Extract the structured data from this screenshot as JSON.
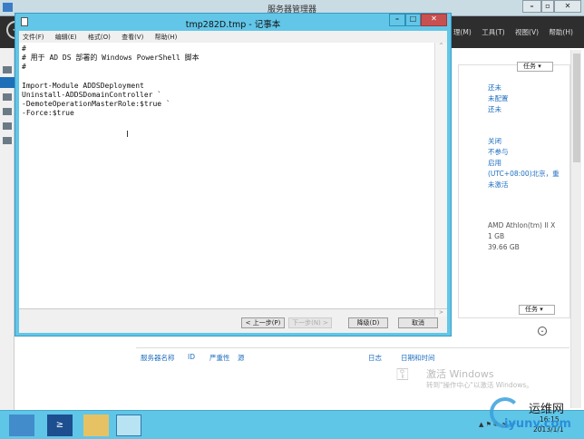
{
  "server_manager": {
    "title": "服务器管理器",
    "menu": [
      "理(M)",
      "工具(T)",
      "视图(V)",
      "帮助(H)"
    ],
    "tasks_label": "任务",
    "properties": {
      "links_a": [
        "还未",
        "未配置",
        "还未"
      ],
      "links_b": [
        "关闭",
        "不参与",
        "启用",
        "(UTC+08:00)北京，重",
        "未激活"
      ],
      "hardware": [
        "AMD Athlon(tm) II X",
        "1 GB",
        "39.66 GB"
      ]
    },
    "events": {
      "tasks_label": "任务",
      "columns": [
        "服务器名称",
        "ID",
        "严重性",
        "源",
        "日志",
        "日期和时间"
      ]
    }
  },
  "notepad": {
    "title": "tmp282D.tmp - 记事本",
    "menu": [
      "文件(F)",
      "编辑(E)",
      "格式(O)",
      "查看(V)",
      "帮助(H)"
    ],
    "content": "#\n# 用于 AD DS 部署的 Windows PowerShell 脚本\n#\n\nImport-Module ADDSDeployment\nUninstall-ADDSDomainController `\n-DemoteOperationMasterRole:$true `\n-Force:$true"
  },
  "wizard": {
    "prev": "< 上一步(P)",
    "next": "下一步(N) >",
    "demote": "降级(D)",
    "cancel": "取消"
  },
  "watermark": {
    "title": "激活 Windows",
    "subtitle": "转到\"操作中心\"以激活 Windows。",
    "site": "运维网",
    "site_url": "iyunv.com"
  },
  "clock": {
    "time": "16:15",
    "date": "2013/1/1"
  },
  "colors": {
    "accent": "#62c6e8",
    "link": "#1f6fc0",
    "close": "#c75050"
  }
}
